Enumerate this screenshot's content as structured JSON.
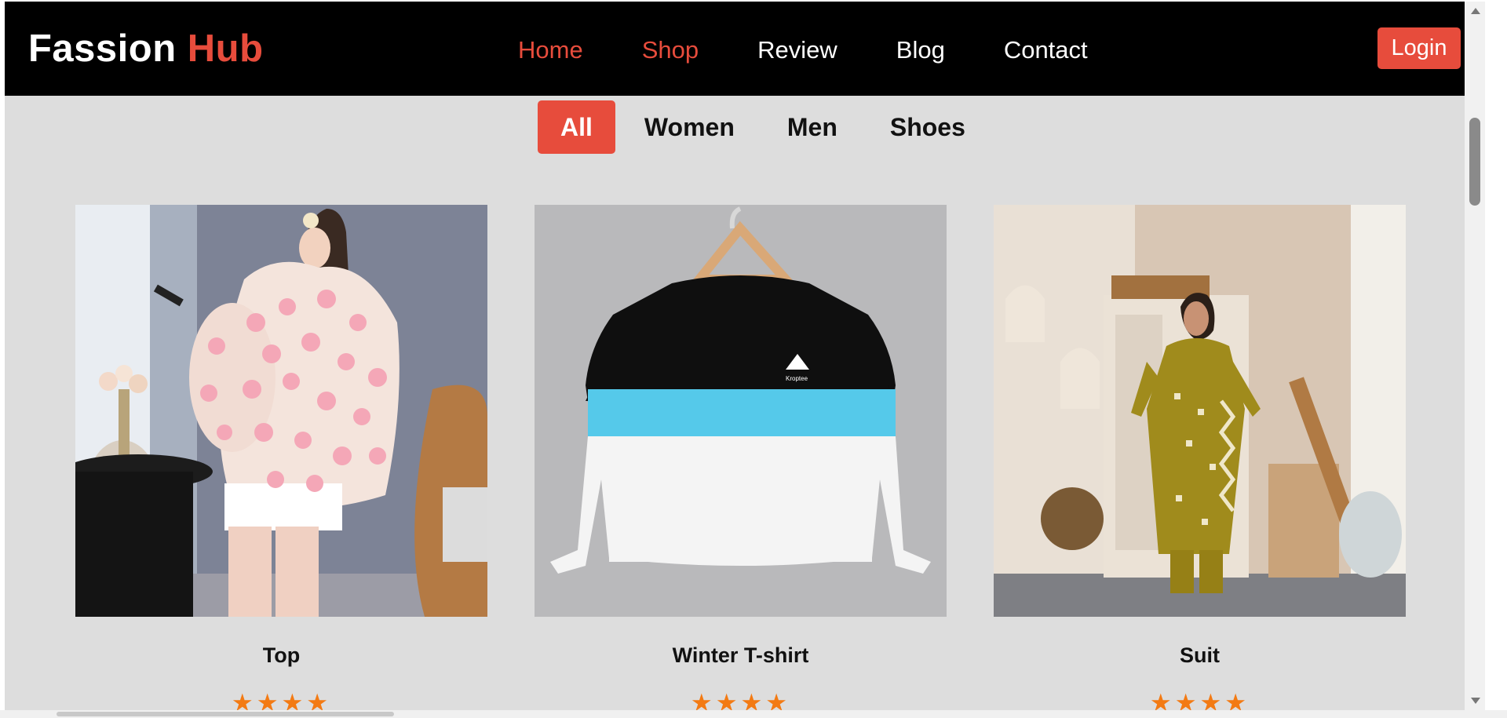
{
  "header": {
    "brand_main": "Fassion",
    "brand_accent": "Hub",
    "nav": [
      {
        "label": "Home",
        "active": true
      },
      {
        "label": "Shop",
        "active": true
      },
      {
        "label": "Review",
        "active": false
      },
      {
        "label": "Blog",
        "active": false
      },
      {
        "label": "Contact",
        "active": false
      }
    ],
    "login_label": "Login"
  },
  "filters": [
    {
      "label": "All",
      "active": true
    },
    {
      "label": "Women",
      "active": false
    },
    {
      "label": "Men",
      "active": false
    },
    {
      "label": "Shoes",
      "active": false
    }
  ],
  "products": [
    {
      "title": "Top",
      "rating": 4,
      "stars": "★★★★"
    },
    {
      "title": "Winter T-shirt",
      "rating": 4,
      "stars": "★★★★"
    },
    {
      "title": "Suit",
      "rating": 4,
      "stars": "★★★★"
    }
  ],
  "colors": {
    "accent": "#e74c3c",
    "header_bg": "#000000",
    "page_bg": "#dddddd",
    "star": "#f37a13"
  }
}
